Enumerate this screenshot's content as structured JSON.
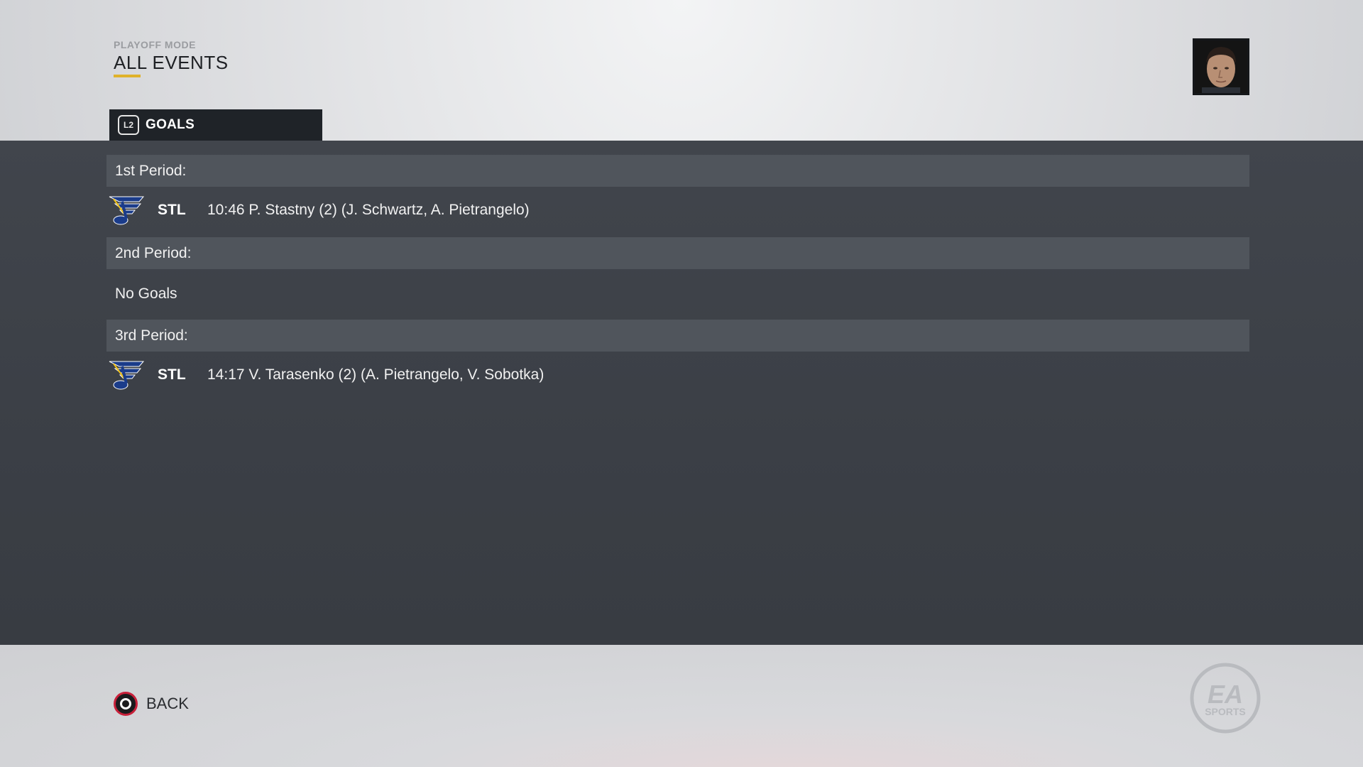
{
  "header": {
    "mode_label": "PLAYOFF MODE",
    "title": "ALL EVENTS"
  },
  "tab": {
    "button_hint": "L2",
    "label": "GOALS"
  },
  "periods": [
    {
      "label": "1st Period:",
      "goals": [
        {
          "team": "STL",
          "text": "10:46 P. Stastny (2) (J. Schwartz, A. Pietrangelo)"
        }
      ]
    },
    {
      "label": "2nd Period:",
      "no_goals_text": "No Goals"
    },
    {
      "label": "3rd Period:",
      "goals": [
        {
          "team": "STL",
          "text": "14:17 V. Tarasenko (2) (A. Pietrangelo, V. Sobotka)"
        }
      ]
    }
  ],
  "footer": {
    "back_label": "BACK",
    "brand_text_top": "EA",
    "brand_text_bottom": "SPORTS"
  },
  "icons": {
    "team_logo": "st-louis-blues-note-icon",
    "avatar": "player-avatar",
    "back_button": "circle-button-icon",
    "brand": "ea-sports-logo"
  },
  "colors": {
    "accent_underline": "#e0b22a",
    "panel_bg": "#3e4248",
    "period_header_bg": "#50555c",
    "tab_bg": "#1f2328",
    "team_blue": "#1b3c8a",
    "back_button_ring": "#c8203a"
  }
}
